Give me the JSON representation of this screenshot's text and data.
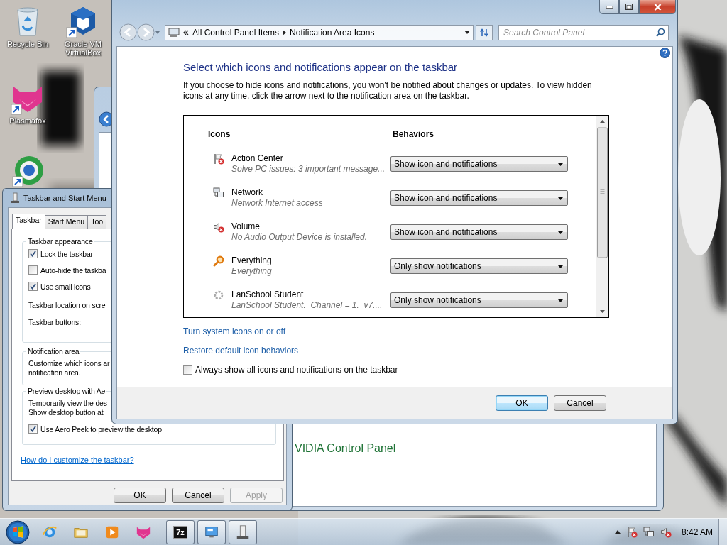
{
  "desktop_icons": [
    {
      "kind": "recycle-bin",
      "label": "Recycle Bin",
      "shortcut": false
    },
    {
      "kind": "virtualbox",
      "label": "Oracle VM VirtualBox",
      "shortcut": true
    },
    {
      "kind": "plasmafox",
      "label": "Plasmafox",
      "shortcut": true
    },
    {
      "kind": "globe",
      "shortcut": true
    }
  ],
  "background_window": {
    "heading": "VIDIA Control Panel"
  },
  "taskbar_dialog": {
    "title": "Taskbar and Start Menu",
    "tabs": [
      {
        "label": "Taskbar",
        "selected": true
      },
      {
        "label": "Start Menu",
        "selected": false
      },
      {
        "label": "Too",
        "selected": false
      }
    ],
    "groups": [
      {
        "title": "Taskbar appearance",
        "items": [
          {
            "kind": "checkbox",
            "label": "Lock the taskbar",
            "checked": true
          },
          {
            "kind": "checkbox",
            "label": "Auto-hide the taskba",
            "checked": false
          },
          {
            "kind": "checkbox",
            "label": "Use small icons",
            "checked": true
          },
          {
            "kind": "label",
            "label": "Taskbar location on scre"
          },
          {
            "kind": "label",
            "label": "Taskbar buttons:"
          }
        ]
      },
      {
        "title": "Notification area",
        "items": [
          {
            "kind": "text",
            "label": "Customize which icons ar"
          },
          {
            "kind": "text",
            "label": "notification area."
          }
        ]
      },
      {
        "title": "Preview desktop with Ae",
        "items": [
          {
            "kind": "text",
            "label": "Temporarily view the des"
          },
          {
            "kind": "text",
            "label": "Show desktop button at"
          },
          {
            "kind": "checkbox",
            "label": "Use Aero Peek to preview the desktop",
            "checked": true
          }
        ]
      }
    ],
    "help_link": "How do I customize the taskbar?",
    "buttons": [
      {
        "label": "OK",
        "disabled": false
      },
      {
        "label": "Cancel",
        "disabled": false
      },
      {
        "label": "Apply",
        "disabled": true
      }
    ]
  },
  "control_panel": {
    "address": [
      "All Control Panel Items",
      "Notification Area Icons"
    ],
    "search": {
      "placeholder": "Search Control Panel"
    },
    "heading": "Select which icons and notifications appear on the taskbar",
    "description": "If you choose to hide icons and notifications, you won't be notified about changes or updates. To view hidden icons at any time, click the arrow next to the notification area on the taskbar.",
    "columns": [
      "Icons",
      "Behaviors"
    ],
    "rows": [
      {
        "kind": "action-center",
        "name": "Action Center",
        "detail": "Solve PC issues: 3 important message...",
        "behavior": "Show icon and notifications"
      },
      {
        "kind": "network",
        "name": "Network",
        "detail": "Network Internet access",
        "behavior": "Show icon and notifications"
      },
      {
        "kind": "volume",
        "name": "Volume",
        "detail": "No Audio Output Device is installed.",
        "behavior": "Show icon and notifications"
      },
      {
        "kind": "everything",
        "name": "Everything",
        "detail": "Everything",
        "behavior": "Only show notifications"
      },
      {
        "kind": "lanschool",
        "name": "LanSchool Student",
        "detail": "LanSchool Student.  Channel = 1.  v7....",
        "behavior": "Only show notifications"
      }
    ],
    "links": [
      "Turn system icons on or off",
      "Restore default icon behaviors"
    ],
    "always_show": {
      "label": "Always show all icons and notifications on the taskbar",
      "checked": false
    },
    "buttons": [
      {
        "label": "OK",
        "default": true
      },
      {
        "label": "Cancel",
        "default": false
      }
    ]
  },
  "taskbar": {
    "apps": [
      {
        "kind": "ie",
        "open": false
      },
      {
        "kind": "folder",
        "open": false
      },
      {
        "kind": "media",
        "open": false
      },
      {
        "kind": "plasmafox",
        "open": false
      },
      {
        "kind": "sevenzip",
        "label": "7z",
        "open": true
      },
      {
        "kind": "control-panel",
        "open": true
      },
      {
        "kind": "taskbar-properties",
        "open": true
      }
    ],
    "tray": [
      {
        "kind": "action-center"
      },
      {
        "kind": "network"
      },
      {
        "kind": "volume"
      }
    ],
    "clock": "8:42 AM"
  }
}
